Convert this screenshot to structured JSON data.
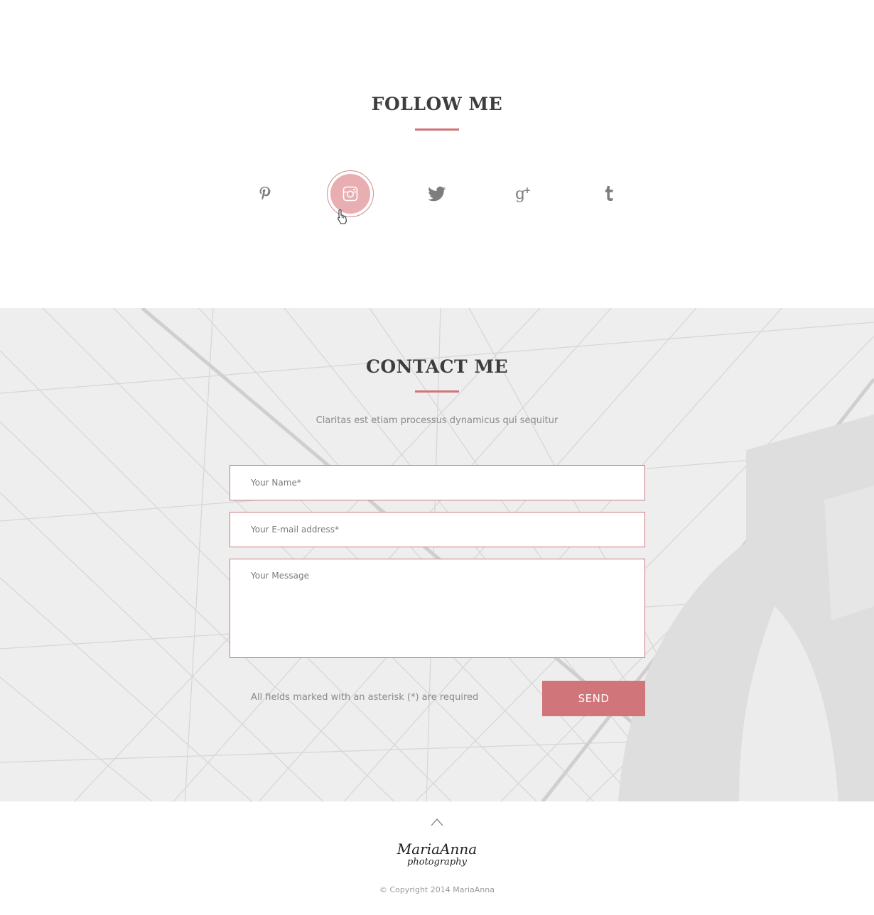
{
  "colors": {
    "accent": "#d07579",
    "accent_light": "#e9aeb1",
    "icon_gray": "#7d7d7d"
  },
  "follow": {
    "title": "FOLLOW ME",
    "icons": [
      {
        "name": "pinterest-icon",
        "active": false
      },
      {
        "name": "instagram-icon",
        "active": true
      },
      {
        "name": "twitter-icon",
        "active": false
      },
      {
        "name": "google-plus-icon",
        "active": false
      },
      {
        "name": "tumblr-icon",
        "active": false
      }
    ]
  },
  "contact": {
    "title": "CONTACT ME",
    "subtitle": "Claritas est etiam processus dynamicus qui sequitur",
    "form": {
      "name_placeholder": "Your Name*",
      "email_placeholder": "Your E-mail address*",
      "message_placeholder": "Your Message",
      "required_note": "All fields marked with an asterisk (*) are required",
      "send_label": "SEND"
    }
  },
  "footer": {
    "logo_line1": "MariaAnna",
    "logo_line2": "photography",
    "copyright": "© Copyright 2014 MariaAnna"
  }
}
